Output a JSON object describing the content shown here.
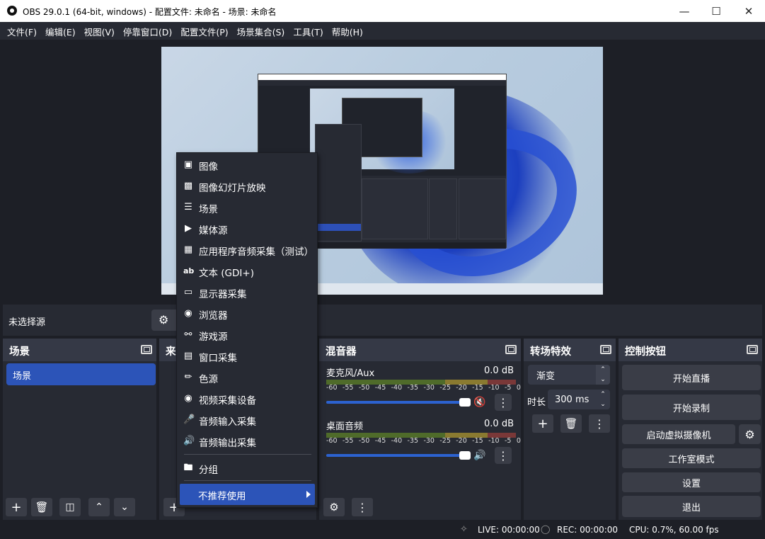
{
  "window": {
    "title": "OBS 29.0.1 (64-bit, windows) - 配置文件: 未命名 - 场景: 未命名"
  },
  "menubar": [
    "文件(F)",
    "编辑(E)",
    "视图(V)",
    "停靠窗口(D)",
    "配置文件(P)",
    "场景集合(S)",
    "工具(T)",
    "帮助(H)"
  ],
  "source_bar": {
    "no_source": "未选择源"
  },
  "scenes": {
    "title": "场景",
    "items": [
      "场景"
    ]
  },
  "sources": {
    "title": "来"
  },
  "mixer": {
    "title": "混音器",
    "scale": [
      "-60",
      "-55",
      "-50",
      "-45",
      "-40",
      "-35",
      "-30",
      "-25",
      "-20",
      "-15",
      "-10",
      "-5",
      "0"
    ],
    "channels": [
      {
        "name": "麦克风/Aux",
        "db": "0.0 dB",
        "muted": true,
        "volume": 1.0
      },
      {
        "name": "桌面音频",
        "db": "0.0 dB",
        "muted": false,
        "volume": 1.0
      }
    ]
  },
  "transitions": {
    "title": "转场特效",
    "type": "渐变",
    "duration_label": "时长",
    "duration": "300 ms"
  },
  "controls": {
    "title": "控制按钮",
    "start_stream": "开始直播",
    "start_record": "开始录制",
    "virtual_cam": "启动虚拟摄像机",
    "studio_mode": "工作室模式",
    "settings": "设置",
    "exit": "退出"
  },
  "context_menu": {
    "items": [
      {
        "icon": "image-icon",
        "label": "图像"
      },
      {
        "icon": "slideshow-icon",
        "label": "图像幻灯片放映"
      },
      {
        "icon": "list-icon",
        "label": "场景"
      },
      {
        "icon": "play-icon",
        "label": "媒体源"
      },
      {
        "icon": "app-audio-icon",
        "label": "应用程序音频采集（测试）"
      },
      {
        "icon": "text-icon",
        "label": "文本 (GDI+)"
      },
      {
        "icon": "monitor-icon",
        "label": "显示器采集"
      },
      {
        "icon": "globe-icon",
        "label": "浏览器"
      },
      {
        "icon": "gamepad-icon",
        "label": "游戏源"
      },
      {
        "icon": "window-icon",
        "label": "窗口采集"
      },
      {
        "icon": "brush-icon",
        "label": "色源"
      },
      {
        "icon": "camera-icon",
        "label": "视频采集设备"
      },
      {
        "icon": "microphone-icon",
        "label": "音频输入采集"
      },
      {
        "icon": "speaker-icon",
        "label": "音频输出采集"
      }
    ],
    "group": {
      "icon": "folder-icon",
      "label": "分组"
    },
    "deprecated": "不推荐使用"
  },
  "status": {
    "live": "LIVE: 00:00:00",
    "rec": "REC: 00:00:00",
    "cpu": "CPU: 0.7%, 60.00 fps"
  }
}
